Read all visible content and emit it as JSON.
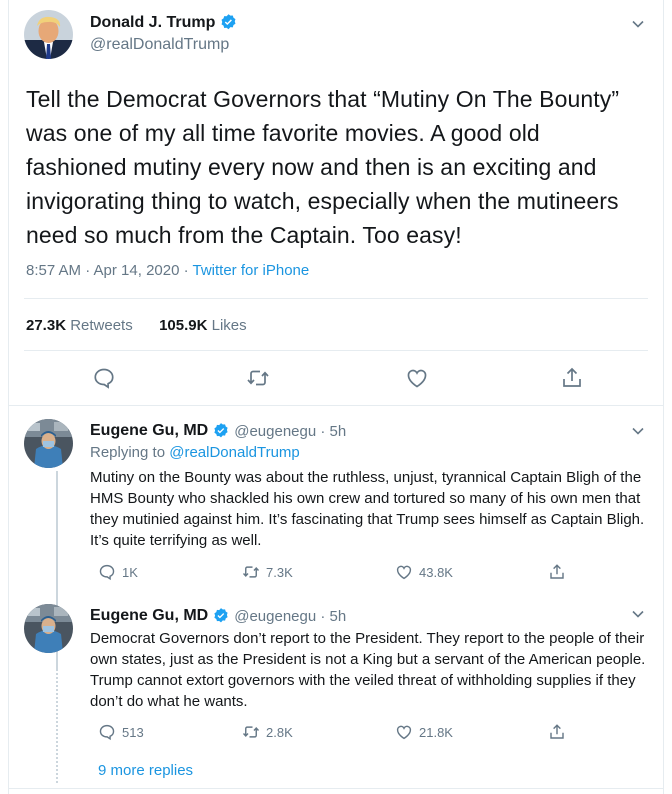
{
  "main_tweet": {
    "name": "Donald J. Trump",
    "handle": "@realDonaldTrump",
    "text": "Tell the Democrat Governors that “Mutiny On The Bounty” was one of my all time favorite movies. A good old fashioned mutiny every now and then is an exciting and invigorating thing to watch, especially when the mutineers need so much from the Captain. Too easy!",
    "time": "8:57 AM · Apr 14, 2020 · ",
    "source": "Twitter for iPhone",
    "retweets_count": "27.3K",
    "retweets_label": " Retweets",
    "likes_count": "105.9K",
    "likes_label": " Likes"
  },
  "replies": [
    {
      "name": "Eugene Gu, MD",
      "handle": "@eugenegu · 5h",
      "replying_prefix": "Replying to ",
      "replying_to": "@realDonaldTrump",
      "text": "Mutiny on the Bounty was about the ruthless, unjust, tyrannical Captain Bligh of the HMS Bounty who shackled his own crew and tortured so many of his own men that they mutinied against him. It’s fascinating that Trump sees himself as Captain Bligh. It’s quite terrifying as well.",
      "reply_count": "1K",
      "retweet_count": "7.3K",
      "like_count": "43.8K"
    },
    {
      "name": "Eugene Gu, MD",
      "handle": "@eugenegu · 5h",
      "text": "Democrat Governors don’t report to the President. They report to the people of their own states, just as the President is not a King but a servant of the American people. Trump cannot extort governors with the veiled threat of withholding supplies if they don’t do what he wants.",
      "reply_count": "513",
      "retweet_count": "2.8K",
      "like_count": "21.8K"
    }
  ],
  "more_replies": "9 more replies",
  "colors": {
    "accent": "#1b95e0",
    "muted": "#657786",
    "verified": "#1da1f2"
  },
  "icons": [
    "verified-badge-icon",
    "chevron-down-icon",
    "reply-icon",
    "retweet-icon",
    "like-icon",
    "share-icon"
  ]
}
